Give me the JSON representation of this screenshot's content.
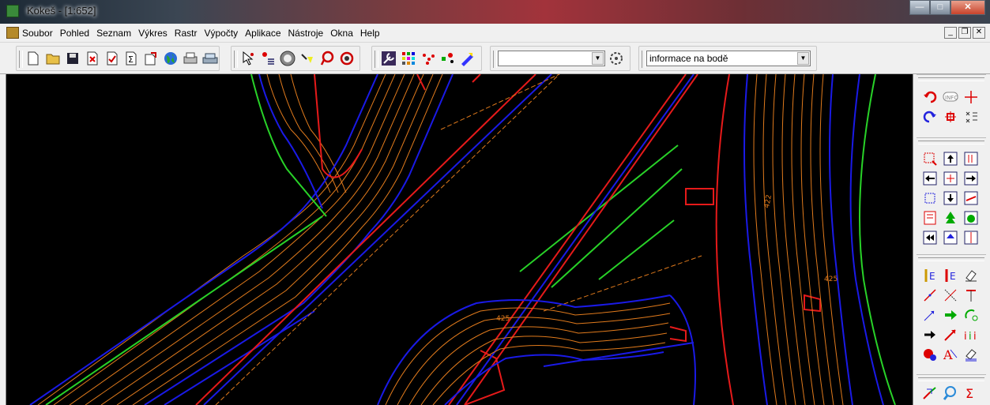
{
  "window": {
    "title": "Kokeš - [1:652]",
    "minimize": "—",
    "maximize": "□",
    "close": "✕"
  },
  "menu": {
    "items": [
      "Soubor",
      "Pohled",
      "Seznam",
      "Výkres",
      "Rastr",
      "Výpočty",
      "Aplikace",
      "Nástroje",
      "Okna",
      "Help"
    ]
  },
  "mdi": {
    "minimize": "_",
    "restore": "❐",
    "close": "✕"
  },
  "toolbar": {
    "file_icons": [
      "new-file",
      "open-folder",
      "save",
      "print-setup",
      "check",
      "sum",
      "export",
      "globe",
      "printer",
      "plotter"
    ],
    "info_icons": [
      "point-info",
      "point-select",
      "measure",
      "lasso",
      "rotate"
    ],
    "tool_icons": [
      "wrench",
      "palette",
      "dots",
      "points",
      "pen"
    ],
    "layer_combo_value": "",
    "info_combo_value": "informace na bodě"
  },
  "colors": {
    "contour": "#e07a1c",
    "blue_line": "#1a1ae6",
    "red_line": "#e61a1a",
    "green_line": "#28d228",
    "background": "#000000"
  },
  "map_labels": {
    "label1": "425",
    "label2": "425",
    "label3": "422"
  }
}
